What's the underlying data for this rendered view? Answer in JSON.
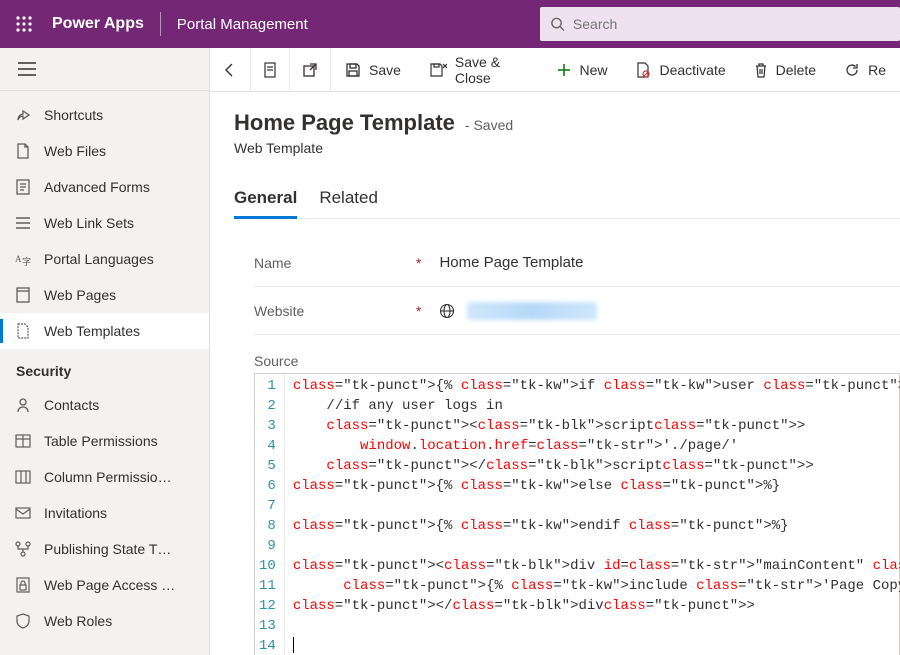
{
  "header": {
    "app_name": "Power Apps",
    "env_name": "Portal Management",
    "search_placeholder": "Search"
  },
  "sidebar": {
    "items": [
      {
        "label": "Shortcuts"
      },
      {
        "label": "Web Files"
      },
      {
        "label": "Advanced Forms"
      },
      {
        "label": "Web Link Sets"
      },
      {
        "label": "Portal Languages"
      },
      {
        "label": "Web Pages"
      },
      {
        "label": "Web Templates"
      }
    ],
    "section_label": "Security",
    "security_items": [
      {
        "label": "Contacts"
      },
      {
        "label": "Table Permissions"
      },
      {
        "label": "Column Permissio…"
      },
      {
        "label": "Invitations"
      },
      {
        "label": "Publishing State T…"
      },
      {
        "label": "Web Page Access …"
      },
      {
        "label": "Web Roles"
      }
    ]
  },
  "commands": {
    "save": "Save",
    "save_close": "Save & Close",
    "new": "New",
    "deactivate": "Deactivate",
    "delete": "Delete",
    "refresh": "Re"
  },
  "record": {
    "title": "Home Page Template",
    "status": "- Saved",
    "entity": "Web Template",
    "tabs": {
      "general": "General",
      "related": "Related"
    },
    "fields": {
      "name_label": "Name",
      "name_value": "Home Page Template",
      "website_label": "Website"
    },
    "source_label": "Source",
    "source_lines": [
      "{% if user %}",
      "    //if any user logs in",
      "    <script>",
      "        window.location.href='./page/'",
      "    </script>",
      "{% else %}",
      "",
      "{% endif %}",
      "",
      "<div id=\"mainContent\" class = \"wrapper-body\" role=\"main\">",
      "      {% include 'Page Copy' %}",
      "</div>",
      "",
      ""
    ]
  }
}
